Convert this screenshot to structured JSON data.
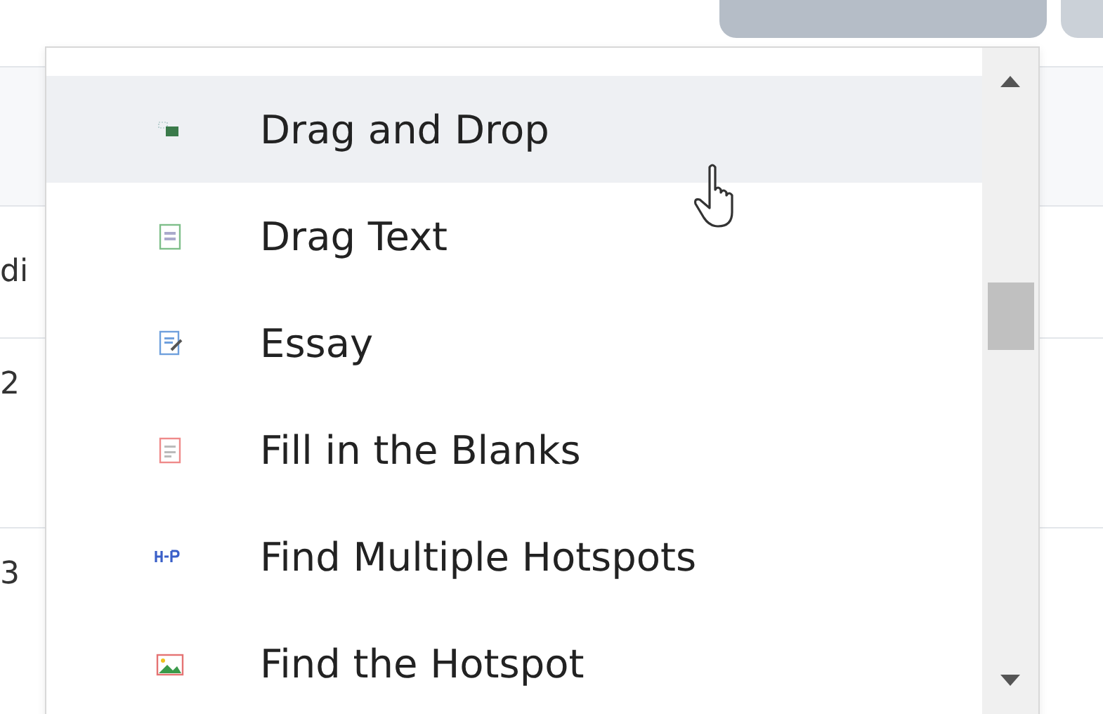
{
  "table": {
    "rows": [
      {
        "cell": "di"
      },
      {
        "cell": "2"
      },
      {
        "cell": "3"
      }
    ]
  },
  "dropdown": {
    "items": [
      {
        "kind": "drag-drop",
        "label": "Drag and Drop",
        "highlighted": true
      },
      {
        "kind": "drag-text",
        "label": "Drag Text",
        "highlighted": false
      },
      {
        "kind": "essay",
        "label": "Essay",
        "highlighted": false
      },
      {
        "kind": "fill-blanks",
        "label": "Fill in the Blanks",
        "highlighted": false
      },
      {
        "kind": "multi-hotspot",
        "label": "Find Multiple Hotspots",
        "highlighted": false
      },
      {
        "kind": "hotspot",
        "label": "Find the Hotspot",
        "highlighted": false
      }
    ]
  }
}
